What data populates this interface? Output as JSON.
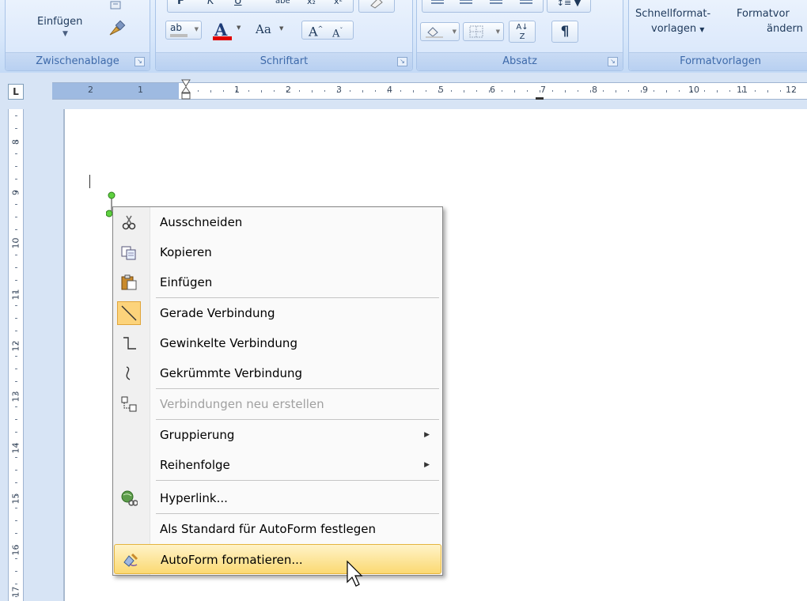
{
  "ribbon": {
    "clipboard": {
      "paste_label": "Einfügen",
      "title": "Zwischenablage"
    },
    "font": {
      "title": "Schriftart",
      "font_size_label": "Aa"
    },
    "paragraph": {
      "title": "Absatz"
    },
    "styles": {
      "quick_styles_line1": "Schnellformat-",
      "quick_styles_line2": "vorlagen",
      "change_line1": "Formatvor",
      "change_line2": "ändern",
      "title": "Formatvorlagen"
    }
  },
  "ruler": {
    "horizontal_numbers": [
      "2",
      "1",
      "1",
      "2",
      "3",
      "4",
      "5",
      "6",
      "7",
      "8",
      "9",
      "10",
      "11",
      "12"
    ],
    "vertical_numbers": [
      "8",
      "9",
      "10",
      "11",
      "12",
      "13",
      "14",
      "15",
      "16",
      "17"
    ],
    "tab_selector": "L"
  },
  "context_menu": {
    "items": [
      {
        "label": "Ausschneiden",
        "icon": "scissors-icon",
        "enabled": true
      },
      {
        "label": "Kopieren",
        "icon": "copy-icon",
        "enabled": true
      },
      {
        "label": "Einfügen",
        "icon": "paste-icon",
        "enabled": true
      },
      {
        "label": "Gerade Verbindung",
        "icon": "straight-connector-icon",
        "enabled": true,
        "checked": true
      },
      {
        "label": "Gewinkelte Verbindung",
        "icon": "elbow-connector-icon",
        "enabled": true
      },
      {
        "label": "Gekrümmte Verbindung",
        "icon": "curved-connector-icon",
        "enabled": true
      },
      {
        "label": "Verbindungen neu erstellen",
        "icon": "reroute-connectors-icon",
        "enabled": false
      },
      {
        "label": "Gruppierung",
        "icon": "",
        "enabled": true,
        "submenu": true
      },
      {
        "label": "Reihenfolge",
        "icon": "",
        "enabled": true,
        "submenu": true
      },
      {
        "label": "Hyperlink...",
        "icon": "hyperlink-icon",
        "enabled": true
      },
      {
        "label": "Als Standard für AutoForm festlegen",
        "icon": "",
        "enabled": true
      },
      {
        "label": "AutoForm formatieren...",
        "icon": "format-shape-icon",
        "enabled": true,
        "highlighted": true
      }
    ]
  },
  "colors": {
    "ribbon_bg": "#dce9fb",
    "ruler_bg": "#d7e4f5",
    "menu_highlight": "#fbd972",
    "font_color_red": "#e00000"
  }
}
